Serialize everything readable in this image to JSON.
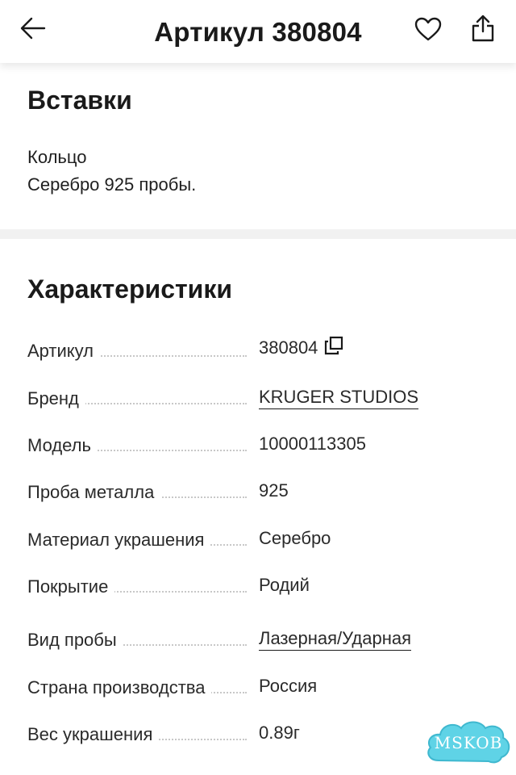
{
  "header": {
    "title": "Артикул 380804",
    "back_icon": "arrow-left-icon",
    "favorite_icon": "heart-icon",
    "share_icon": "share-icon"
  },
  "inserts": {
    "title": "Вставки",
    "line1": "Кольцо",
    "line2": "Серебро 925 пробы."
  },
  "characteristics": {
    "title": "Характеристики",
    "rows": [
      {
        "label": "Артикул",
        "value": "380804"
      },
      {
        "label": "Бренд",
        "value": "KRUGER STUDIOS"
      },
      {
        "label": "Модель",
        "value": "10000113305"
      },
      {
        "label": "Проба металла",
        "value": "925"
      },
      {
        "label": "Материал украшения",
        "value": "Серебро"
      },
      {
        "label": "Покрытие",
        "value": "Родий"
      },
      {
        "label": "Вид пробы",
        "value": "Лазерная/Ударная"
      },
      {
        "label": "Страна производства",
        "value": "Россия"
      },
      {
        "label": "Вес украшения",
        "value": "0.89г"
      }
    ]
  },
  "watermark": {
    "text": "MSKOB",
    "color": "#5fd3e6"
  }
}
